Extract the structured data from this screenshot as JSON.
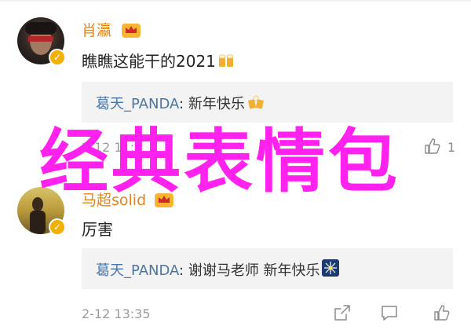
{
  "comments": [
    {
      "username": "肖瀛",
      "text": "瞧瞧这能干的2021",
      "reply": {
        "name": "葛天_PANDA",
        "sep": ": ",
        "text": "新年快乐"
      },
      "time": "2-12 11:2",
      "likes": "1"
    },
    {
      "username": "马超solid",
      "text": "厉害",
      "reply": {
        "name": "葛天_PANDA",
        "sep": ": ",
        "text": "谢谢马老师 新年快乐"
      },
      "time": "2-12 13:35",
      "likes": ""
    }
  ],
  "overlay_text": "经典表情包",
  "colors": {
    "username": "#e2861c",
    "reply_name": "#4a76a8",
    "overlay": "#ff22ee",
    "verified": "#f2b100"
  },
  "icons": [
    "verified-badge-icon",
    "crown-icon",
    "beer-icon",
    "share-icon",
    "comment-icon",
    "like-icon",
    "sparkler-icon"
  ]
}
